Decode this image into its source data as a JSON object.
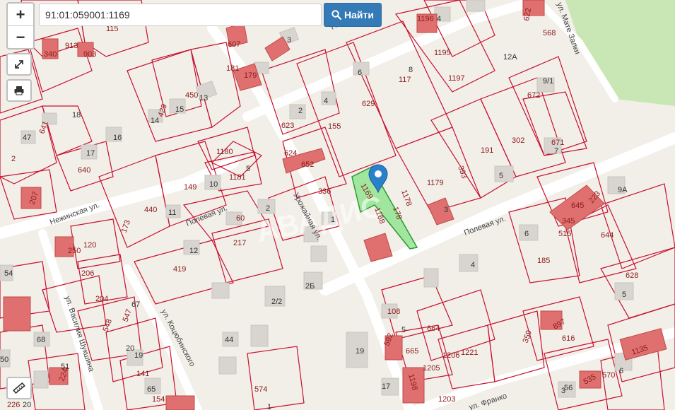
{
  "search": {
    "value": "91:01:059001:1169",
    "button_label": "Найти"
  },
  "controls": {
    "zoom_in": "+",
    "zoom_out": "−"
  },
  "watermark": "АВАДИС",
  "streets": [
    {
      "name": "Нежинская ул."
    },
    {
      "name": "Полевая ул."
    },
    {
      "name": "Полевая ул."
    },
    {
      "name": "Урожайная ул."
    },
    {
      "name": "ул. Василия Шукшина"
    },
    {
      "name": "ул. Коцюбинского"
    },
    {
      "name": "ул. Мате Залки"
    },
    {
      "name": "Новая ул."
    },
    {
      "name": "ул. Франко"
    }
  ],
  "parcel_labels": [
    "115",
    "913",
    "903",
    "340",
    "607",
    "181",
    "179",
    "1196",
    "1195",
    "1197",
    "117",
    "629",
    "155",
    "623",
    "624",
    "652",
    "336",
    "1169",
    "1168",
    "1178",
    "1179",
    "393",
    "191",
    "302",
    "672",
    "671",
    "641",
    "640",
    "2",
    "207",
    "1180",
    "1181",
    "149",
    "440",
    "173",
    "60",
    "217",
    "419",
    "250",
    "120",
    "206",
    "204",
    "547",
    "548",
    "108",
    "664",
    "665",
    "1206",
    "1221",
    "1205",
    "1203",
    "1198",
    "592",
    "359",
    "897",
    "616",
    "645",
    "223",
    "345",
    "515",
    "644",
    "185",
    "628",
    "1135",
    "570",
    "535",
    "224",
    "226",
    "154",
    "141",
    "574",
    "450",
    "429",
    "622",
    "568",
    "178"
  ],
  "house_labels": [
    "3",
    "8",
    "6",
    "12A",
    "9/1",
    "7",
    "5",
    "4",
    "2",
    "14",
    "15",
    "13",
    "16",
    "17",
    "18",
    "47",
    "1",
    "3",
    "10",
    "11",
    "12",
    "5",
    "2",
    "6",
    "4",
    "5",
    "3",
    "2/2",
    "2Б",
    "44",
    "19",
    "17",
    "20",
    "19",
    "65",
    "67",
    "68",
    "54",
    "50",
    "51",
    "56",
    "1",
    "9А",
    "6",
    "5",
    "4",
    "20",
    "3"
  ]
}
